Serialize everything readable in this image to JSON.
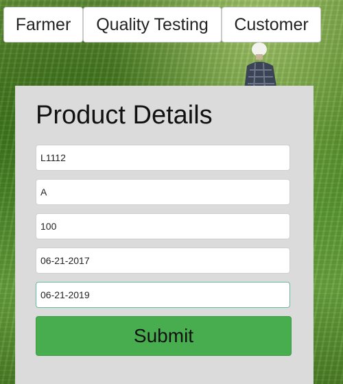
{
  "nav": {
    "farmer": "Farmer",
    "quality_testing": "Quality Testing",
    "customer": "Customer"
  },
  "card": {
    "title": "Product Details"
  },
  "form": {
    "fields": [
      {
        "value": "L1112"
      },
      {
        "value": "A"
      },
      {
        "value": "100"
      },
      {
        "value": "06-21-2017"
      },
      {
        "value": "06-21-2019"
      }
    ],
    "submit_label": "Submit"
  },
  "colors": {
    "card_bg": "#dcdbdc",
    "submit_bg": "#47ad4f",
    "focus_border": "#66b99a"
  }
}
